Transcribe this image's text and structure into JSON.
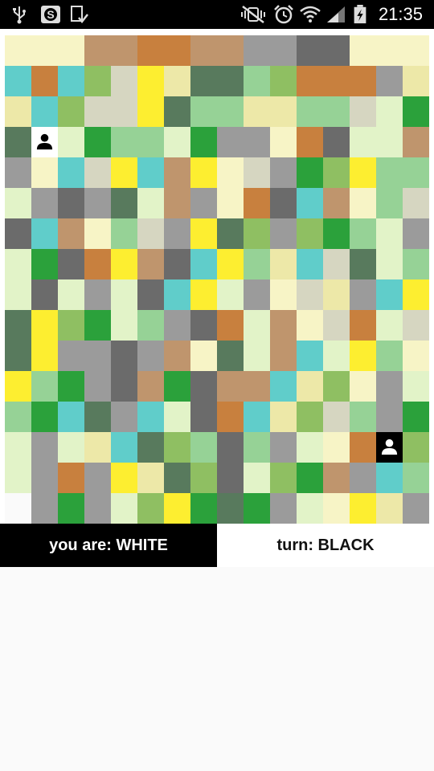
{
  "status_bar": {
    "time": "21:35",
    "icons": [
      "usb-icon",
      "app-s-icon",
      "download-check-icon",
      "vibrate-mute-icon",
      "alarm-icon",
      "wifi-icon",
      "signal-icon",
      "battery-charging-icon"
    ]
  },
  "game": {
    "rows": 16,
    "cols": 16,
    "palette": {
      "c": "#f7f4c6",
      "b": "#bf956d",
      "o": "#c8803e",
      "g": "#9b9b9b",
      "d": "#6b6b6b",
      "t": "#60cdca",
      "l": "#8fbf62",
      "k": "#d6d6c1",
      "y": "#fdee30",
      "p": "#ede8a8",
      "s": "#587a5d",
      "m": "#96d296",
      "G": "#2ba13b",
      "n": "#e2f3c8",
      "W": "#fafafa"
    },
    "grid": [
      "cccbboobbggddccc",
      "totlkypssmlooogp",
      "ptlkkysmmppmmknG",
      "sWnGmmnGggcodnnb",
      "gctkytbyckgGlymm",
      "ngdgsnbgcodtbcmk",
      "dtbcmkgyslglGmng",
      "nGdoybdtymptksnm",
      "ndngndtyngckpgty",
      "sylGnmgdonbckonk",
      "syggdgbcsnbtnymc",
      "ymGgdbGdbbtplcgn",
      "mGtsgtndotplkmgG",
      "ngnptslmdmgncoWl",
      "ngogypsldnlGbgtm",
      "WgGgnlyGsGgncypg"
    ],
    "pieces": [
      {
        "row": 3,
        "col": 1,
        "color": "white",
        "icon": "person-icon"
      },
      {
        "row": 13,
        "col": 14,
        "color": "black",
        "icon": "person-icon"
      }
    ]
  },
  "footer": {
    "you_are": "you are: WHITE",
    "turn": "turn: BLACK"
  }
}
